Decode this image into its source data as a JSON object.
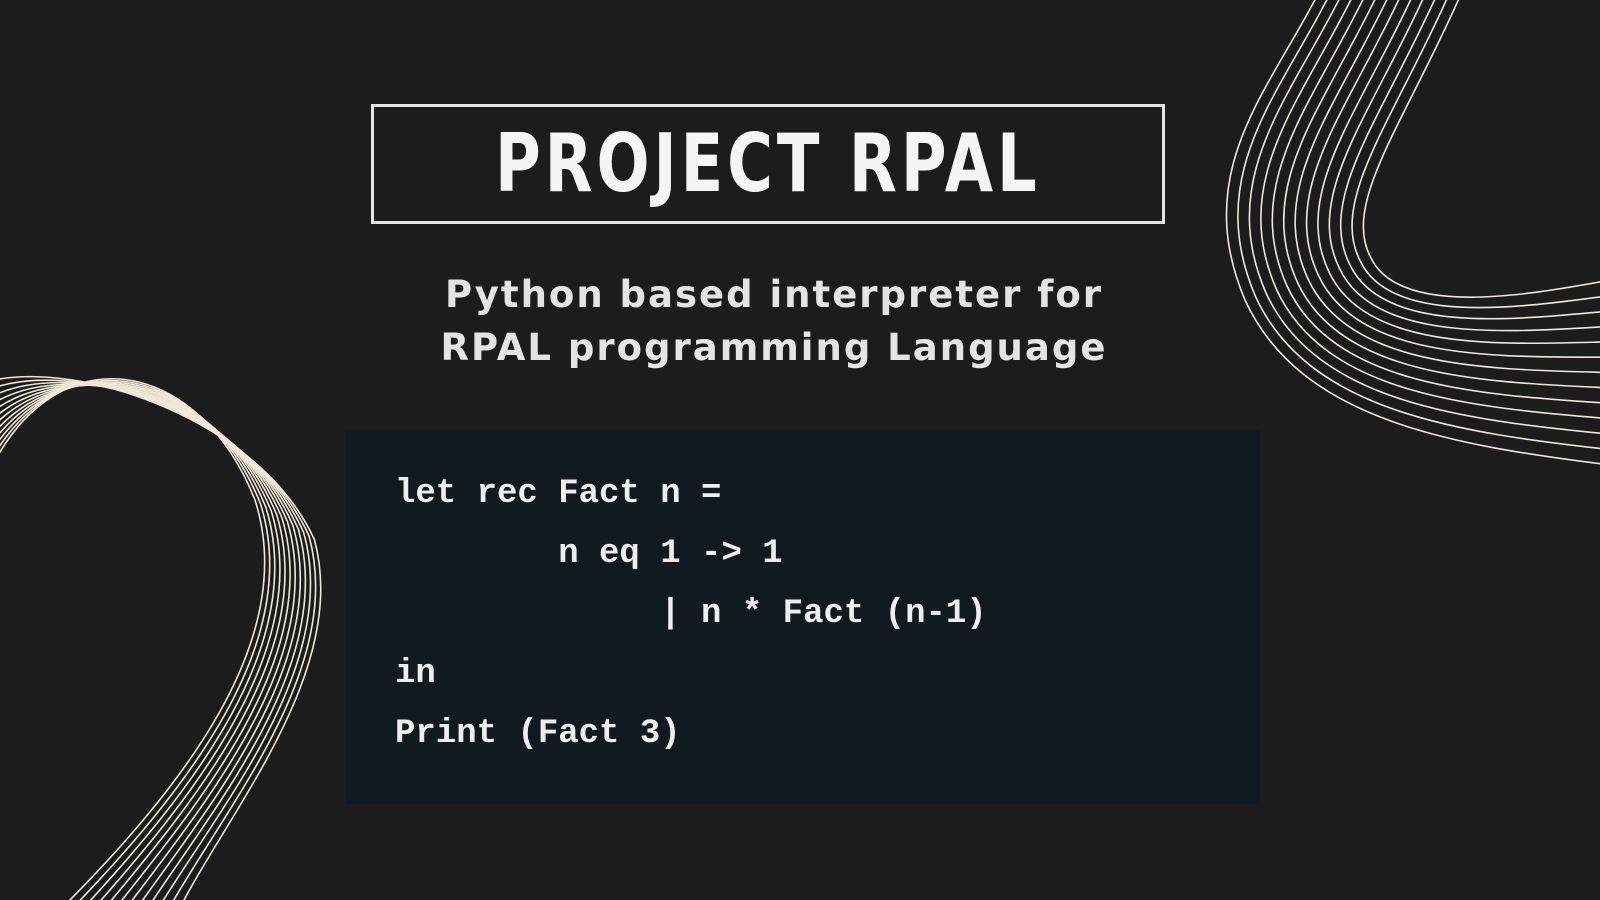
{
  "slide": {
    "title": "PROJECT RPAL",
    "subtitle_lines": [
      "Python based interpreter for",
      "RPAL programming Language"
    ],
    "code_lines": [
      "let rec Fact n =",
      "        n eq 1 -> 1",
      "             | n * Fact (n-1)",
      "in",
      "Print (Fact 3)"
    ]
  },
  "colors": {
    "background": "#1c1c1c",
    "code_background": "#111a1e",
    "text": "#f5f5f5",
    "wave_lines": "#efe8d8"
  }
}
